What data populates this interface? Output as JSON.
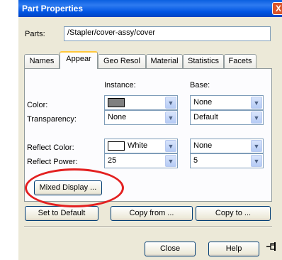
{
  "window": {
    "title": "Part Properties",
    "close_glyph": "X"
  },
  "parts": {
    "label": "Parts:",
    "value": "/Stapler/cover-assy/cover"
  },
  "tabs": [
    {
      "label": "Names",
      "active": false
    },
    {
      "label": "Appear",
      "active": true
    },
    {
      "label": "Geo Resol",
      "active": false
    },
    {
      "label": "Material",
      "active": false
    },
    {
      "label": "Statistics",
      "active": false
    },
    {
      "label": "Facets",
      "active": false
    }
  ],
  "columns": {
    "instance": "Instance:",
    "base": "Base:"
  },
  "rows": {
    "color": {
      "label": "Color:",
      "instance": "",
      "instance_color": "#808080",
      "base": "None"
    },
    "transparency": {
      "label": "Transparency:",
      "instance": "None",
      "base": "Default"
    },
    "reflect_color": {
      "label": "Reflect Color:",
      "instance": "White",
      "instance_color": "#ffffff",
      "base": "None"
    },
    "reflect_power": {
      "label": "Reflect Power:",
      "instance": "25",
      "base": "5"
    }
  },
  "buttons": {
    "mixed_display": "Mixed Display ...",
    "set_default": "Set to Default",
    "copy_from": "Copy from ...",
    "copy_to": "Copy to ...",
    "close": "Close",
    "help": "Help"
  },
  "icons": {
    "dropdown": "chevron-down-icon",
    "pin": "pin-icon"
  },
  "colors": {
    "title_bar": "#0054e3",
    "annotation": "#e32020",
    "tab_highlight": "#ffc83c"
  }
}
